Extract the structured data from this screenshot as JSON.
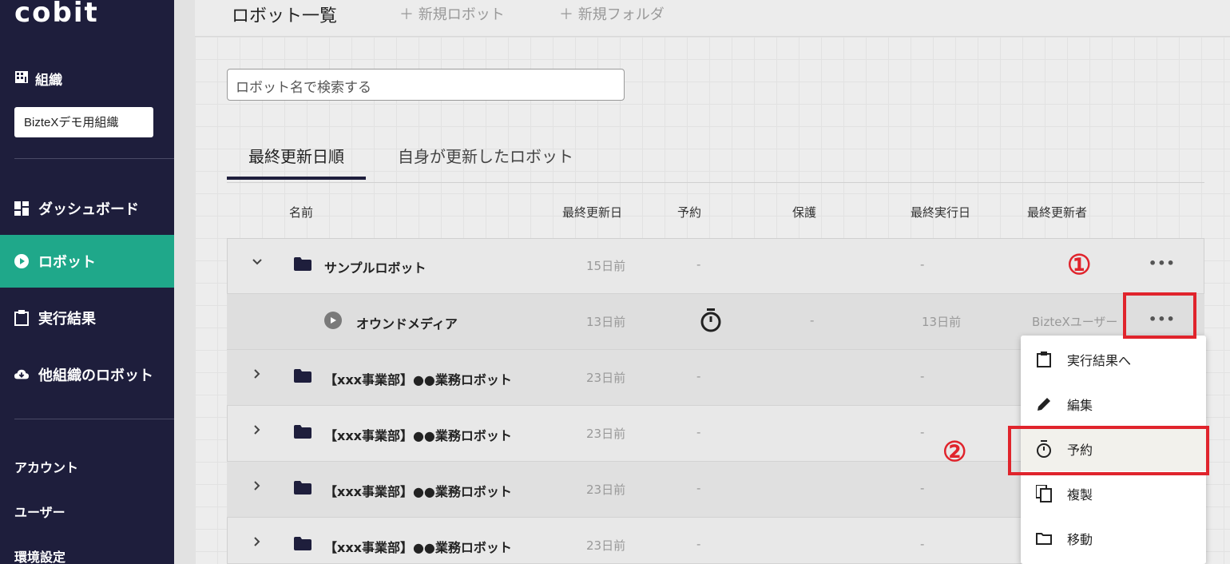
{
  "sidebar": {
    "logo": "cobit",
    "org_label": "組織",
    "org_value": "BizteXデモ用組織",
    "nav": [
      {
        "label": "ダッシュボード",
        "icon": "dashboard-icon"
      },
      {
        "label": "ロボット",
        "icon": "play-circle-icon"
      },
      {
        "label": "実行結果",
        "icon": "clipboard-icon"
      },
      {
        "label": "他組織のロボット",
        "icon": "cloud-download-icon"
      }
    ],
    "sub": [
      "アカウント",
      "ユーザー",
      "環境設定"
    ]
  },
  "topbar": {
    "title": "ロボット一覧",
    "new_robot": "＋ 新規ロボット",
    "new_folder": "＋ 新規フォルダ"
  },
  "search": {
    "placeholder": "ロボット名で検索する"
  },
  "tabs": [
    "最終更新日順",
    "自身が更新したロボット"
  ],
  "columns": [
    "名前",
    "最終更新日",
    "予約",
    "保護",
    "最終実行日",
    "最終更新者"
  ],
  "rows": [
    {
      "name": "サンプルロボット",
      "updated": "15日前",
      "reserve": "-",
      "protect": "",
      "last_run": "-",
      "updater": "",
      "type": "folder",
      "expanded": true
    },
    {
      "name": "オウンドメディア",
      "updated": "13日前",
      "reserve": "timer",
      "protect": "-",
      "last_run": "13日前",
      "updater": "BizteXユーザー",
      "type": "robot"
    },
    {
      "name": "【xxx事業部】●●業務ロボット",
      "updated": "23日前",
      "reserve": "-",
      "last_run": "-",
      "type": "folder"
    },
    {
      "name": "【xxx事業部】●●業務ロボット",
      "updated": "23日前",
      "reserve": "-",
      "last_run": "-",
      "type": "folder"
    },
    {
      "name": "【xxx事業部】●●業務ロボット",
      "updated": "23日前",
      "reserve": "-",
      "last_run": "-",
      "type": "folder"
    },
    {
      "name": "【xxx事業部】●●業務ロボット",
      "updated": "23日前",
      "reserve": "-",
      "last_run": "-",
      "type": "folder"
    }
  ],
  "menu": [
    {
      "label": "実行結果へ",
      "icon": "clipboard-icon"
    },
    {
      "label": "編集",
      "icon": "pencil-icon"
    },
    {
      "label": "予約",
      "icon": "timer-icon"
    },
    {
      "label": "複製",
      "icon": "copy-icon"
    },
    {
      "label": "移動",
      "icon": "folder-icon"
    }
  ],
  "annotations": {
    "marker1": "①",
    "marker2": "②"
  },
  "colors": {
    "sidebar": "#1e1e3c",
    "active": "#1fa88a",
    "highlight": "#e0242c"
  }
}
